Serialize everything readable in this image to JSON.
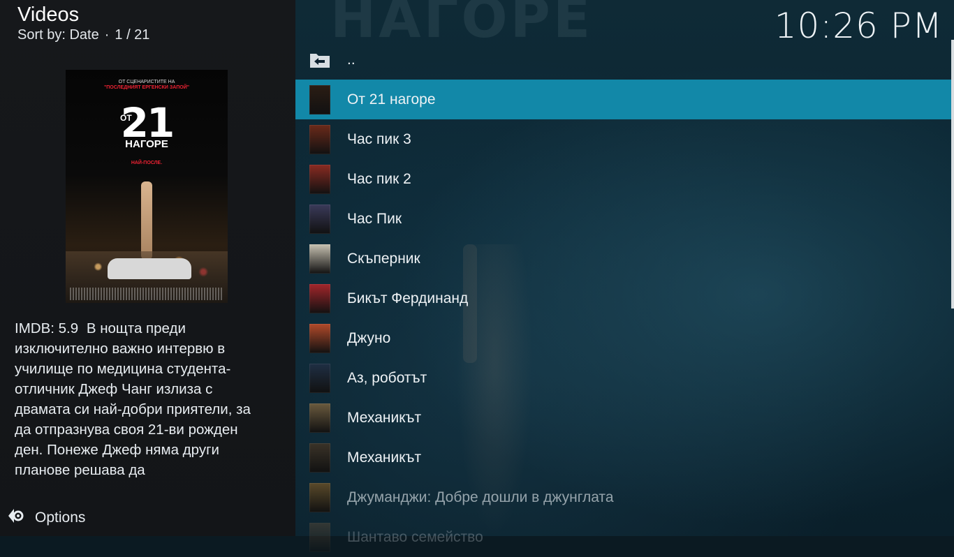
{
  "header": {
    "title": "Videos",
    "sort_label": "Sort by: Date",
    "position": "1 / 21"
  },
  "clock": "10:26 PM",
  "poster": {
    "tagline_top": "ОТ СЦЕНАРИСТИТЕ НА",
    "tagline_red": "\"ПОСЛЕДНИЯТ ЕРГЕНСКИ ЗАПОЙ\"",
    "number": "21",
    "prefix": "ОТ",
    "word": "НАГОРЕ",
    "slogan": "НАЙ-ПОСЛЕ."
  },
  "plot": {
    "imdb": "IMDB: 5.9",
    "text": "В нощта преди изключително важно интервю в училище по медицина студента-отличник Джеф Чанг излиза с двамата си най-добри приятели, за да отпразнува своя 21-ви рожден ден. Понеже Джеф няма други планове решава да"
  },
  "options_label": "Options",
  "list": {
    "parent_label": "..",
    "items": [
      {
        "label": "От 21 нагоре",
        "color": "#2b1d14"
      },
      {
        "label": "Час пик 3",
        "color": "#6b2a1a"
      },
      {
        "label": "Час пик 2",
        "color": "#8a2b22"
      },
      {
        "label": "Час Пик",
        "color": "#3b3b5a"
      },
      {
        "label": "Скъперник",
        "color": "#c8c2b2"
      },
      {
        "label": "Бикът Фердинанд",
        "color": "#a3262b"
      },
      {
        "label": "Джуно",
        "color": "#b24a2a"
      },
      {
        "label": "Аз, роботът",
        "color": "#1f2f44"
      },
      {
        "label": "Механикът",
        "color": "#6a5a3e"
      },
      {
        "label": "Механикът",
        "color": "#3a3328"
      },
      {
        "label": "Джуманджи: Добре дошли в джунглата",
        "color": "#5a4a2a"
      },
      {
        "label": "Шантаво семейство",
        "color": "#7a5a3a"
      }
    ]
  },
  "colors": {
    "accent": "#1288a8",
    "left_panel": "#16181b"
  }
}
